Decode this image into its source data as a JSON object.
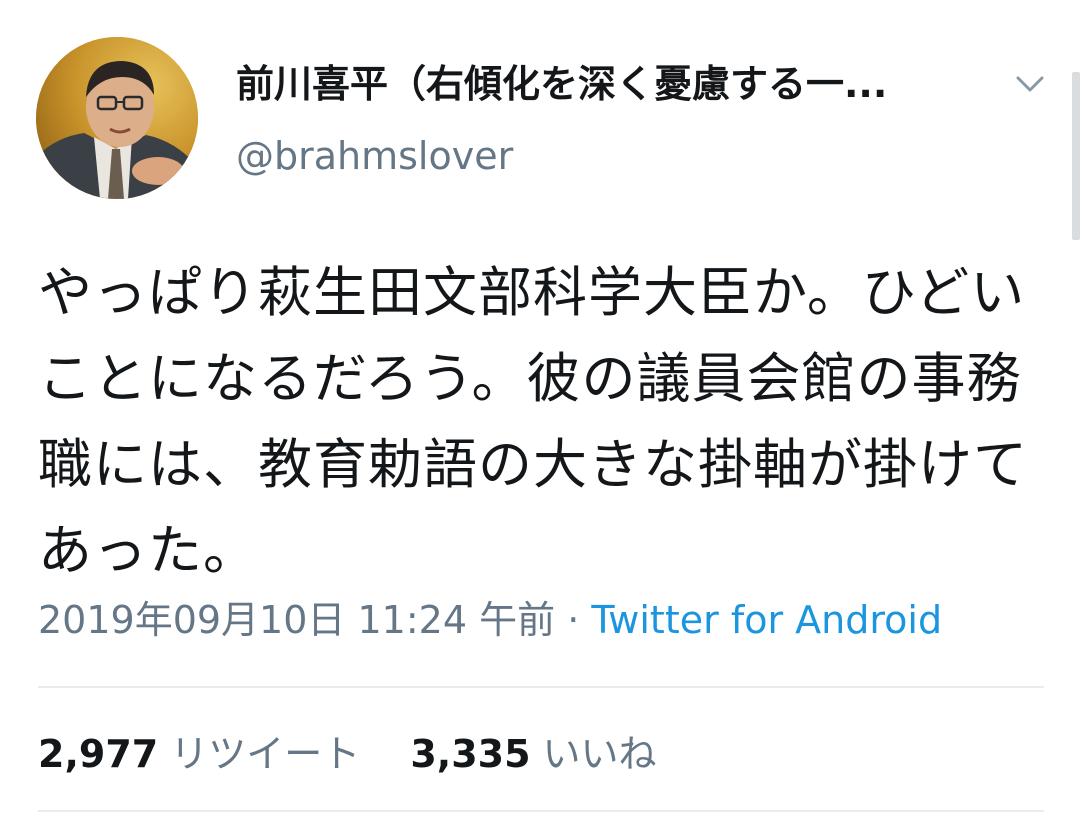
{
  "tweet": {
    "author": {
      "display_name": "前川喜平（右傾化を深く憂慮する一...",
      "handle": "@brahmslover",
      "avatar": "profile-photo"
    },
    "text": "やっぱり萩生田文部科学大臣か。ひどいことになるだろう。彼の議員会館の事務職には、教育勅語の大きな掛軸が掛けてあった。",
    "timestamp": "2019年09月10日 11:24 午前",
    "separator": "·",
    "source": "Twitter for Android",
    "stats": {
      "retweets_count": "2,977",
      "retweets_label": "リツイート",
      "likes_count": "3,335",
      "likes_label": "いいね"
    }
  },
  "colors": {
    "text": "#14171a",
    "secondary_text": "#657786",
    "link": "#1b95e0",
    "divider": "#e6ecf0"
  },
  "icons": {
    "menu": "chevron-down-icon"
  }
}
